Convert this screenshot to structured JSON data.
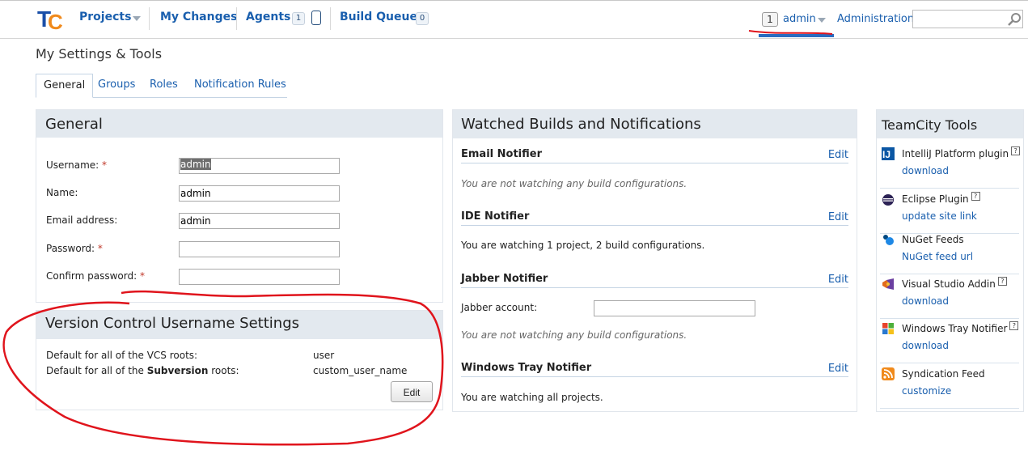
{
  "topbar": {
    "nav": [
      {
        "label": "Projects"
      },
      {
        "label": "My Changes"
      },
      {
        "label": "Agents",
        "badge": "1"
      },
      {
        "label": "Build Queue",
        "badge": "0"
      }
    ],
    "user_count": "1",
    "user_name": "admin",
    "admin_link": "Administration",
    "search_placeholder": ""
  },
  "page_title": "My Settings & Tools",
  "tabs": [
    {
      "label": "General",
      "active": true
    },
    {
      "label": "Groups"
    },
    {
      "label": "Roles"
    },
    {
      "label": "Notification Rules"
    }
  ],
  "general": {
    "title": "General",
    "fields": [
      {
        "label": "Username:",
        "required": "*",
        "value": "admin"
      },
      {
        "label": "Name:",
        "value": "admin"
      },
      {
        "label": "Email address:",
        "value": "admin"
      },
      {
        "label": "Password:",
        "required": "*",
        "value": ""
      },
      {
        "label": "Confirm password:",
        "required": "*",
        "value": ""
      }
    ]
  },
  "vcs": {
    "title": "Version Control Username Settings",
    "row1_label": "Default for all of the VCS roots:",
    "row1_value": "user",
    "row2_prefix": "Default for all of the ",
    "row2_bold": "Subversion",
    "row2_suffix": " roots:",
    "row2_value": "custom_user_name",
    "edit_label": "Edit"
  },
  "watched": {
    "title": "Watched Builds and Notifications",
    "notifiers": [
      {
        "name": "Email Notifier",
        "edit": "Edit",
        "text": "You are not watching any build configurations."
      },
      {
        "name": "IDE Notifier",
        "edit": "Edit",
        "text": "You are watching 1 project, 2 build configurations."
      },
      {
        "name": "Jabber Notifier",
        "edit": "Edit",
        "account_label": "Jabber account:",
        "text": "You are not watching any build configurations."
      },
      {
        "name": "Windows Tray Notifier",
        "edit": "Edit",
        "text": "You are watching all projects."
      }
    ]
  },
  "tools": {
    "title": "TeamCity Tools",
    "items": [
      {
        "name": "IntelliJ Platform plugin",
        "help": "?",
        "link": "download",
        "icon": "intellij-icon"
      },
      {
        "name": "Eclipse Plugin",
        "help": "?",
        "link": "update site link",
        "icon": "eclipse-icon"
      },
      {
        "name": "NuGet Feeds",
        "link": "NuGet feed url",
        "icon": "nuget-icon"
      },
      {
        "name": "Visual Studio Addin",
        "help": "?",
        "link": "download",
        "icon": "visual-studio-icon"
      },
      {
        "name": "Windows Tray Notifier",
        "help": "?",
        "link": "download",
        "icon": "windows-icon"
      },
      {
        "name": "Syndication Feed",
        "link": "customize",
        "icon": "rss-icon"
      }
    ]
  },
  "colors": {
    "link": "#1a5fae",
    "panel_header": "#e3e9ef",
    "annotation": "#e0141c"
  }
}
